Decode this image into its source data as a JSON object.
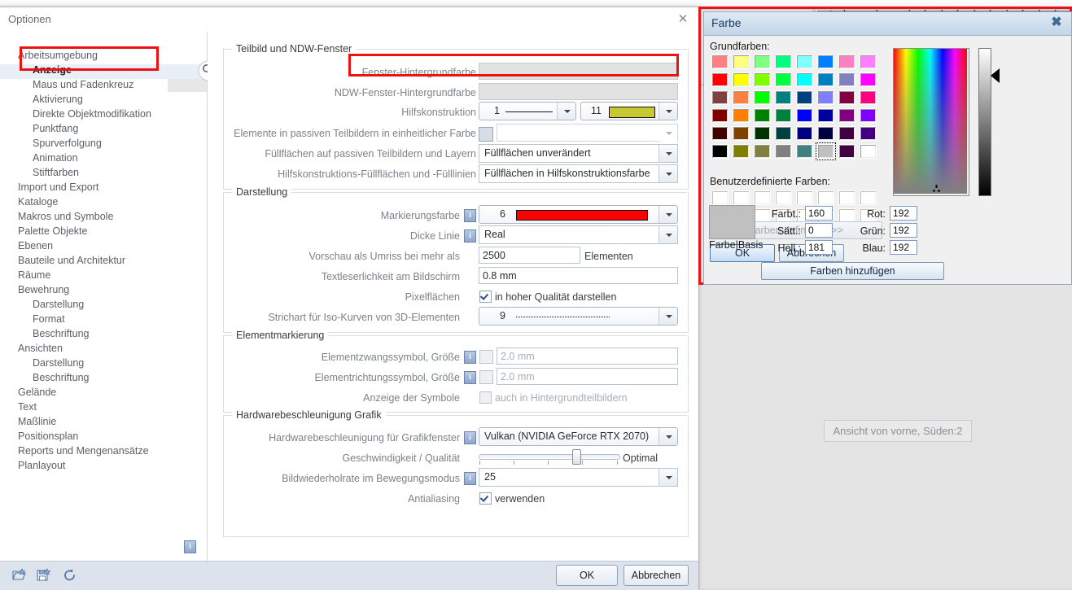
{
  "app": {
    "view_label": "Ansicht von vorne, Süden:2"
  },
  "options_dialog": {
    "title": "Optionen",
    "close_icon": "close-icon",
    "search_icon": "magnifier-icon",
    "sidebar": [
      {
        "label": "Arbeitsumgebung",
        "level": 0,
        "selected": false
      },
      {
        "label": "Anzeige",
        "level": 1,
        "selected": true
      },
      {
        "label": "Maus und Fadenkreuz",
        "level": 1,
        "selected": false
      },
      {
        "label": "Aktivierung",
        "level": 1,
        "selected": false
      },
      {
        "label": "Direkte Objektmodifikation",
        "level": 1,
        "selected": false
      },
      {
        "label": "Punktfang",
        "level": 1,
        "selected": false
      },
      {
        "label": "Spurverfolgung",
        "level": 1,
        "selected": false
      },
      {
        "label": "Animation",
        "level": 1,
        "selected": false
      },
      {
        "label": "Stiftfarben",
        "level": 1,
        "selected": false
      },
      {
        "label": "Import und Export",
        "level": 0,
        "selected": false
      },
      {
        "label": "Kataloge",
        "level": 0,
        "selected": false
      },
      {
        "label": "Makros und Symbole",
        "level": 0,
        "selected": false
      },
      {
        "label": "Palette Objekte",
        "level": 0,
        "selected": false
      },
      {
        "label": "Ebenen",
        "level": 0,
        "selected": false
      },
      {
        "label": "Bauteile und Architektur",
        "level": 0,
        "selected": false
      },
      {
        "label": "Räume",
        "level": 0,
        "selected": false
      },
      {
        "label": "Bewehrung",
        "level": 0,
        "selected": false
      },
      {
        "label": "Darstellung",
        "level": 1,
        "selected": false
      },
      {
        "label": "Format",
        "level": 1,
        "selected": false
      },
      {
        "label": "Beschriftung",
        "level": 1,
        "selected": false
      },
      {
        "label": "Ansichten",
        "level": 0,
        "selected": false
      },
      {
        "label": "Darstellung",
        "level": 1,
        "selected": false
      },
      {
        "label": "Beschriftung",
        "level": 1,
        "selected": false
      },
      {
        "label": "Gelände",
        "level": 0,
        "selected": false
      },
      {
        "label": "Text",
        "level": 0,
        "selected": false
      },
      {
        "label": "Maßlinie",
        "level": 0,
        "selected": false
      },
      {
        "label": "Positionsplan",
        "level": 0,
        "selected": false
      },
      {
        "label": "Reports und Mengenansätze",
        "level": 0,
        "selected": false
      },
      {
        "label": "Planlayout",
        "level": 0,
        "selected": false
      }
    ],
    "groups": {
      "teilbild": {
        "caption": "Teilbild und NDW-Fenster",
        "rows": {
          "fenster_hintergrundfarbe": {
            "label": "Fenster-Hintergrundfarbe",
            "value": ""
          },
          "ndw_fenster_hintergrundfarbe": {
            "label": "NDW-Fenster-Hintergrundfarbe",
            "value": ""
          },
          "hilfskonstruktion": {
            "label": "Hilfskonstruktion",
            "pen": "1",
            "color_index": "11"
          },
          "passive_farbe": {
            "label": "Elemente in passiven Teilbildern in einheitlicher Farbe",
            "checked": false,
            "value": ""
          },
          "fuellflaechen_passiv": {
            "label": "Füllflächen auf passiven Teilbildern und Layern",
            "value": "Füllflächen unverändert"
          },
          "hilfskonstruktions_fuell": {
            "label": "Hilfskonstruktions-Füllflächen und -Fülllinien",
            "value": "Füllflächen in Hilfskonstruktionsfarbe"
          }
        }
      },
      "darstellung": {
        "caption": "Darstellung",
        "rows": {
          "markierungsfarbe": {
            "label": "Markierungsfarbe",
            "value": "6",
            "info": true
          },
          "dicke_linie": {
            "label": "Dicke Linie",
            "value": "Real",
            "info": true
          },
          "vorschau_umriss": {
            "label": "Vorschau als Umriss bei mehr als",
            "value": "2500",
            "suffix": "Elementen"
          },
          "textleserlichkeit": {
            "label": "Textleserlichkeit am Bildschirm",
            "value": "0.8 mm"
          },
          "pixelflaechen": {
            "label": "Pixelflächen",
            "checked": true,
            "check_label": "in hoher Qualität darstellen"
          },
          "strichart_iso": {
            "label": "Strichart für Iso-Kurven von 3D-Elementen",
            "value": "9"
          }
        }
      },
      "elementmarkierung": {
        "caption": "Elementmarkierung",
        "rows": {
          "elementzwangssymbol": {
            "label": "Elementzwangssymbol, Größe",
            "value": "2.0 mm",
            "checked": false,
            "info": true
          },
          "elementrichtungssymbol": {
            "label": "Elementrichtungssymbol, Größe",
            "value": "2.0 mm",
            "checked": false,
            "info": true
          },
          "anzeige_symbole": {
            "label": "Anzeige der Symbole",
            "checked": false,
            "check_label": "auch in Hintergrundteilbildern"
          }
        }
      },
      "hardware": {
        "caption": "Hardwarebeschleunigung Grafik",
        "rows": {
          "hw_grafikfenster": {
            "label": "Hardwarebeschleunigung für Grafikfenster",
            "value": "Vulkan (NVIDIA GeForce RTX 2070)",
            "info": true
          },
          "geschwindigkeit": {
            "label": "Geschwindigkeit / Qualität",
            "value": "Optimal",
            "slider_pct": 60
          },
          "bildwiederholrate": {
            "label": "Bildwiederholrate im Bewegungsmodus",
            "value": "25",
            "info": true
          },
          "antialiasing": {
            "label": "Antialiasing",
            "checked": true,
            "check_label": "verwenden"
          }
        }
      }
    },
    "footer": {
      "icons": [
        "open-favorite-icon",
        "save-favorite-icon",
        "reset-icon"
      ],
      "ok_label": "OK",
      "cancel_label": "Abbrechen"
    },
    "info_icon": "info-icon"
  },
  "color_dialog": {
    "title": "Farbe",
    "close_icon": "close-icon",
    "basic_colors_label": "Grundfarben:",
    "custom_colors_label": "Benutzerdefinierte Farben:",
    "define_colors_label": "Farben definieren >>",
    "ok_label": "OK",
    "cancel_label": "Abbrechen",
    "add_colors_label": "Farben hinzufügen",
    "preview_label": "Farbe|Basis",
    "preview_color": "#c0c0c0",
    "fields": {
      "hue": {
        "label": "Farbt.:",
        "value": "160"
      },
      "sat": {
        "label": "Sätt.:",
        "value": "0"
      },
      "lum": {
        "label": "Hell.:",
        "value": "181"
      },
      "red": {
        "label": "Rot:",
        "value": "192"
      },
      "green": {
        "label": "Grün:",
        "value": "192"
      },
      "blue": {
        "label": "Blau:",
        "value": "192"
      }
    },
    "selected_swatch_index": 45,
    "basic_colors": [
      "#ff8080",
      "#ffff80",
      "#80ff80",
      "#00ff80",
      "#80ffff",
      "#0080ff",
      "#ff80c0",
      "#ff80ff",
      "#ff0000",
      "#ffff00",
      "#80ff00",
      "#00ff40",
      "#00ffff",
      "#0080c0",
      "#8080c0",
      "#ff00ff",
      "#804040",
      "#ff8040",
      "#00ff00",
      "#008080",
      "#004080",
      "#8080ff",
      "#800040",
      "#ff0080",
      "#800000",
      "#ff8000",
      "#008000",
      "#008040",
      "#0000ff",
      "#0000a0",
      "#800080",
      "#8000ff",
      "#400000",
      "#804000",
      "#003300",
      "#004040",
      "#000080",
      "#000040",
      "#400040",
      "#400080",
      "#000000",
      "#808000",
      "#808040",
      "#808080",
      "#408080",
      "#c0c0c0",
      "#400040",
      "#ffffff"
    ],
    "custom_color_slots": 16
  },
  "colors": {
    "highlight_red": "#ee1111",
    "hilfskonstruktion_color": "#c8c832",
    "markierungsfarbe_color": "#ff0000",
    "selection_blue": "#e9eff6"
  }
}
